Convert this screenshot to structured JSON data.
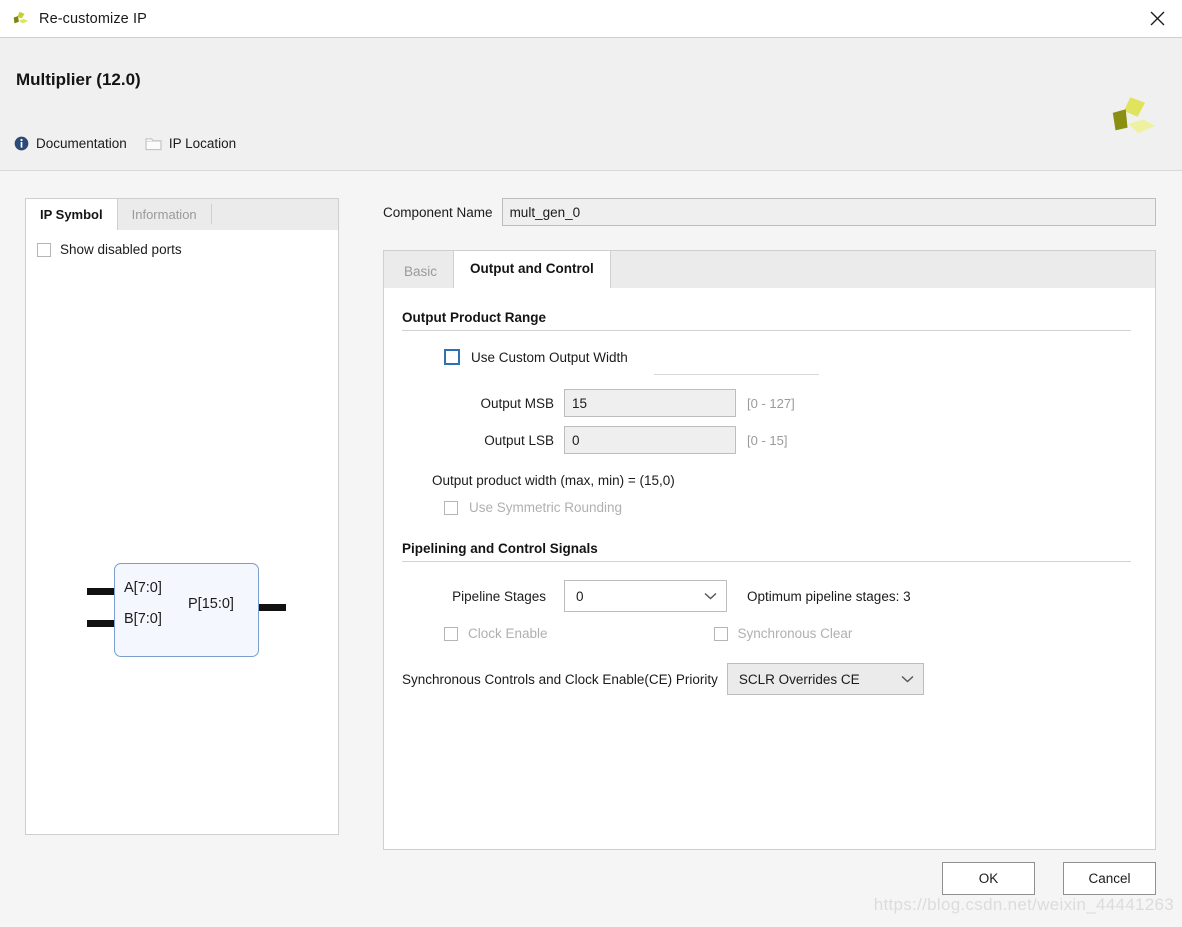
{
  "window": {
    "title": "Re-customize IP",
    "close_label": "✕",
    "logo_name": "xilinx-logo"
  },
  "header": {
    "title": "Multiplier (12.0)",
    "links": [
      {
        "label": "Documentation",
        "icon": "info-icon"
      },
      {
        "label": "IP Location",
        "icon": "folder-icon"
      }
    ]
  },
  "left_panel": {
    "tabs": [
      {
        "label": "IP Symbol",
        "active": true
      },
      {
        "label": "Information",
        "active": false
      }
    ],
    "show_disabled_ports": {
      "label": "Show disabled ports",
      "checked": false
    },
    "symbol": {
      "input_a": "A[7:0]",
      "input_b": "B[7:0]",
      "output_p": "P[15:0]"
    }
  },
  "right_panel": {
    "component_name": {
      "label": "Component Name",
      "value": "mult_gen_0"
    },
    "tabs": [
      {
        "label": "Basic",
        "active": false
      },
      {
        "label": "Output and Control",
        "active": true
      }
    ],
    "output_product_range": {
      "section_title": "Output Product Range",
      "use_custom_output_width": {
        "label": "Use Custom Output Width",
        "checked": false,
        "enabled": true
      },
      "output_msb": {
        "label": "Output MSB",
        "value": "15",
        "range": "[0 - 127]"
      },
      "output_lsb": {
        "label": "Output LSB",
        "value": "0",
        "range": "[0 - 15]"
      },
      "product_width_text": "Output product width (max, min) = (15,0)",
      "use_symmetric_rounding": {
        "label": "Use Symmetric Rounding",
        "checked": false,
        "enabled": false
      }
    },
    "pipelining": {
      "section_title": "Pipelining and Control Signals",
      "pipeline_stages": {
        "label": "Pipeline Stages",
        "value": "0"
      },
      "optimum_text": "Optimum pipeline stages: 3",
      "clock_enable": {
        "label": "Clock Enable",
        "checked": false,
        "enabled": false
      },
      "synchronous_clear": {
        "label": "Synchronous Clear",
        "checked": false,
        "enabled": false
      },
      "priority": {
        "label": "Synchronous Controls and Clock Enable(CE) Priority",
        "value": "SCLR Overrides CE"
      }
    }
  },
  "footer": {
    "ok_label": "OK",
    "cancel_label": "Cancel"
  },
  "watermark": "https://blog.csdn.net/weixin_44441263",
  "colors": {
    "accent_blue": "#2f6fb5",
    "logo_olive": "#8a8f12",
    "logo_yellow": "#dbe04a",
    "symbol_border": "#7b9ecf"
  }
}
